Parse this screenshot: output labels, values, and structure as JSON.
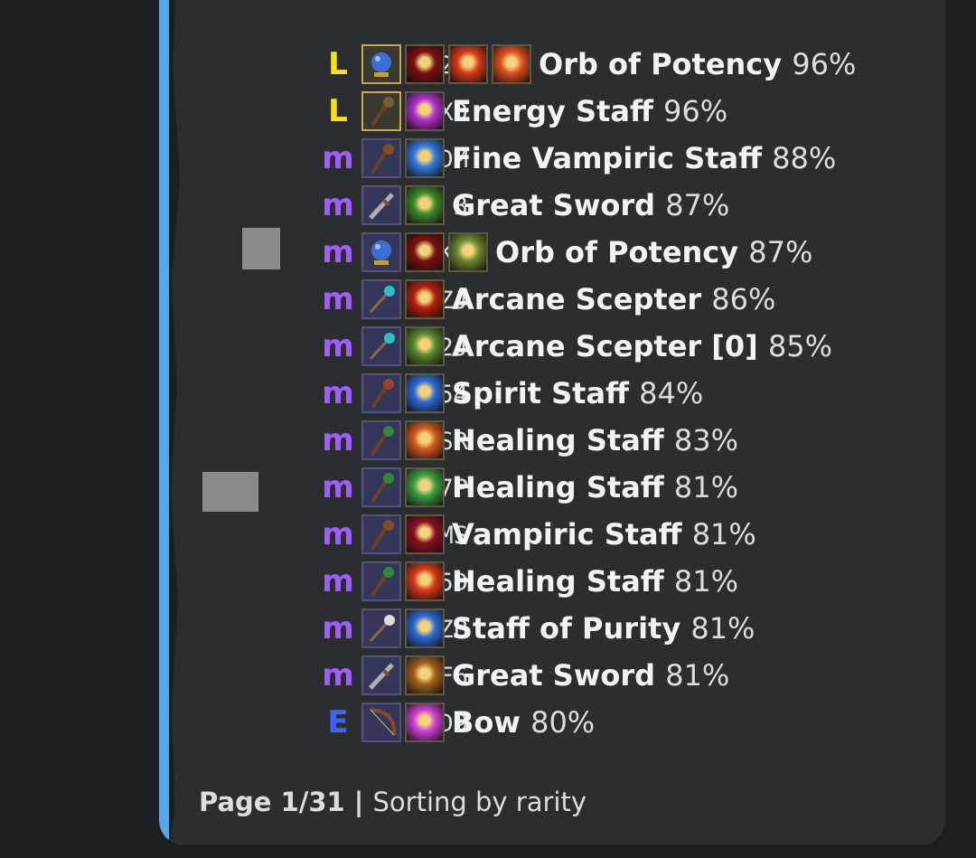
{
  "rows": [
    {
      "code": "J2U",
      "rarity": "L",
      "weapon": "orb",
      "weapon_color": "#3a6fd8",
      "enchants": [
        "#7a1010",
        "#d83a1a",
        "#e05020"
      ],
      "name": "Orb of Potency",
      "pct": "96%"
    },
    {
      "code": "GXD",
      "rarity": "L",
      "weapon": "staff",
      "weapon_color": "#7a5a30",
      "enchants": [
        "#b030d0"
      ],
      "name": "Energy Staff",
      "pct": "96%"
    },
    {
      "code": "DM",
      "rarity": "M",
      "weapon": "staff",
      "weapon_color": "#8a4a20",
      "enchants": [
        "#2f7ae0"
      ],
      "name": "Fine Vampiric Staff",
      "pct": "88%"
    },
    {
      "code": "3",
      "rarity": "M",
      "weapon": "sword",
      "weapon_color": "#b0b0b0",
      "enchants": [
        "#3c8a2a"
      ],
      "name": "Great Sword",
      "pct": "87%"
    },
    {
      "code": "KK",
      "rarity": "M",
      "weapon": "orb",
      "weapon_color": "#3a6fd8",
      "enchants": [
        "#7a1010",
        "#6a8a30"
      ],
      "name": "Orb of Potency",
      "pct": "87%"
    },
    {
      "code": "ZJ",
      "rarity": "M",
      "weapon": "scepter",
      "weapon_color": "#2ec0c8",
      "enchants": [
        "#b02010"
      ],
      "name": "Arcane Scepter",
      "pct": "86%"
    },
    {
      "code": "2J",
      "rarity": "M",
      "weapon": "scepter",
      "weapon_color": "#2ec0c8",
      "enchants": [
        "#5a8a30"
      ],
      "name": "Arcane Scepter [0]",
      "pct": "85%"
    },
    {
      "code": "54",
      "rarity": "M",
      "weapon": "staff",
      "weapon_color": "#a04030",
      "enchants": [
        "#2a6ad8"
      ],
      "name": "Spirit Staff",
      "pct": "84%"
    },
    {
      "code": "KSR",
      "rarity": "M",
      "weapon": "staff",
      "weapon_color": "#2f8a3a",
      "enchants": [
        "#d05a20"
      ],
      "name": "Healing Staff",
      "pct": "83%"
    },
    {
      "code": "L7P",
      "rarity": "M",
      "weapon": "staff",
      "weapon_color": "#2f8a3a",
      "enchants": [
        "#3aa040"
      ],
      "name": "Healing Staff",
      "pct": "81%"
    },
    {
      "code": "IMS",
      "rarity": "M",
      "weapon": "staff",
      "weapon_color": "#8a4a20",
      "enchants": [
        "#8a1020"
      ],
      "name": "Vampiric Staff",
      "pct": "81%"
    },
    {
      "code": "I5D",
      "rarity": "M",
      "weapon": "staff",
      "weapon_color": "#2f8a3a",
      "enchants": [
        "#d83a1a"
      ],
      "name": "Healing Staff",
      "pct": "81%"
    },
    {
      "code": "ZB",
      "rarity": "M",
      "weapon": "scepter",
      "weapon_color": "#d8e0d0",
      "enchants": [
        "#2a6ad8"
      ],
      "name": "Staff of Purity",
      "pct": "81%"
    },
    {
      "code": "F6",
      "rarity": "M",
      "weapon": "sword",
      "weapon_color": "#b0b0b0",
      "enchants": [
        "#a06020"
      ],
      "name": "Great Sword",
      "pct": "81%"
    },
    {
      "code": "AD9",
      "rarity": "E",
      "weapon": "bow",
      "weapon_color": "#8a4a20",
      "enchants": [
        "#d040d8"
      ],
      "name": "Bow",
      "pct": "80%"
    }
  ],
  "footer": {
    "page": "Page 1/31",
    "separator": "|",
    "sort": "Sorting by rarity"
  }
}
